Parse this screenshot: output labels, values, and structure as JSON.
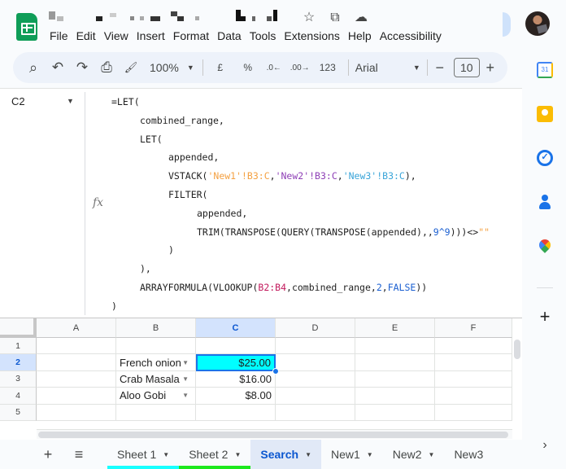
{
  "header": {
    "title_obscured": true,
    "title_icons": [
      {
        "name": "star-icon",
        "glyph": "☆"
      },
      {
        "name": "move-to-folder-icon",
        "glyph": "⧉"
      },
      {
        "name": "cloud-saved-icon",
        "glyph": "☁"
      }
    ],
    "menu": [
      "File",
      "Edit",
      "View",
      "Insert",
      "Format",
      "Data",
      "Tools",
      "Extensions",
      "Help",
      "Accessibility"
    ]
  },
  "toolbar": {
    "search_glyph": "⌕",
    "undo_glyph": "↶",
    "redo_glyph": "↷",
    "print_glyph": "⎙",
    "paint_format_glyph": "🖌",
    "zoom": "100%",
    "currency": "£",
    "percent": "%",
    "decrease_decimal": ".0←",
    "increase_decimal": ".00→",
    "more_formats": "123",
    "font": "Arial",
    "font_size": "10",
    "minus": "−",
    "plus": "+"
  },
  "formula_bar": {
    "name_box": "C2",
    "fx": "fx",
    "lines": [
      {
        "indent": 0,
        "segments": [
          {
            "t": "=LET("
          }
        ]
      },
      {
        "indent": 1,
        "segments": [
          {
            "t": "combined_range,"
          }
        ]
      },
      {
        "indent": 1,
        "segments": [
          {
            "t": "LET("
          }
        ]
      },
      {
        "indent": 2,
        "segments": [
          {
            "t": "appended,"
          }
        ]
      },
      {
        "indent": 2,
        "segments": [
          {
            "t": "VSTACK("
          },
          {
            "t": "'New1'!B3:C",
            "c": "orange"
          },
          {
            "t": ","
          },
          {
            "t": "'New2'!B3:C",
            "c": "purple"
          },
          {
            "t": ","
          },
          {
            "t": "'New3'!B3:C",
            "c": "teal"
          },
          {
            "t": "),"
          }
        ]
      },
      {
        "indent": 2,
        "segments": [
          {
            "t": "FILTER("
          }
        ]
      },
      {
        "indent": 3,
        "segments": [
          {
            "t": "appended,"
          }
        ]
      },
      {
        "indent": 3,
        "segments": [
          {
            "t": "TRIM(TRANSPOSE(QUERY(TRANSPOSE(appended),,"
          },
          {
            "t": "9^9",
            "c": "blue"
          },
          {
            "t": ")))<>"
          },
          {
            "t": "\"\"",
            "c": "orange"
          }
        ]
      },
      {
        "indent": 2,
        "segments": [
          {
            "t": ")"
          }
        ]
      },
      {
        "indent": 1,
        "segments": [
          {
            "t": "),"
          }
        ]
      },
      {
        "indent": 1,
        "segments": [
          {
            "t": "ARRAYFORMULA(VLOOKUP("
          },
          {
            "t": "B2:B4",
            "c": "pink"
          },
          {
            "t": ",combined_range,"
          },
          {
            "t": "2",
            "c": "blue"
          },
          {
            "t": ","
          },
          {
            "t": "FALSE",
            "c": "blue"
          },
          {
            "t": "))"
          }
        ]
      },
      {
        "indent": 0,
        "segments": [
          {
            "t": ")"
          }
        ]
      }
    ]
  },
  "grid": {
    "columns": [
      "A",
      "B",
      "C",
      "D",
      "E",
      "F"
    ],
    "selected_column": "C",
    "rows": [
      "1",
      "2",
      "3",
      "4",
      "5"
    ],
    "selected_row": "2",
    "active_cell": "C2",
    "active_cell_fill": "#00ffff",
    "cells": {
      "B2": "French onion",
      "B3": "Crab Masala",
      "B4": "Aloo Gobi",
      "C2": "$25.00",
      "C3": "$16.00",
      "C4": "$8.00"
    }
  },
  "sheet_tabs": {
    "add_glyph": "+",
    "list_glyph": "≡",
    "tabs": [
      {
        "label": "Sheet 1",
        "color": "#18ffff",
        "active": false
      },
      {
        "label": "Sheet 2",
        "color": "#1de91d",
        "active": false
      },
      {
        "label": "Search",
        "color": null,
        "active": true
      },
      {
        "label": "New1",
        "color": null,
        "active": false
      },
      {
        "label": "New2",
        "color": null,
        "active": false
      },
      {
        "label": "New3",
        "color": null,
        "active": false
      }
    ]
  },
  "side_panel": {
    "calendar_label": "31",
    "tasks_glyph": "✓",
    "add_glyph": "+",
    "expand_glyph": "›"
  }
}
